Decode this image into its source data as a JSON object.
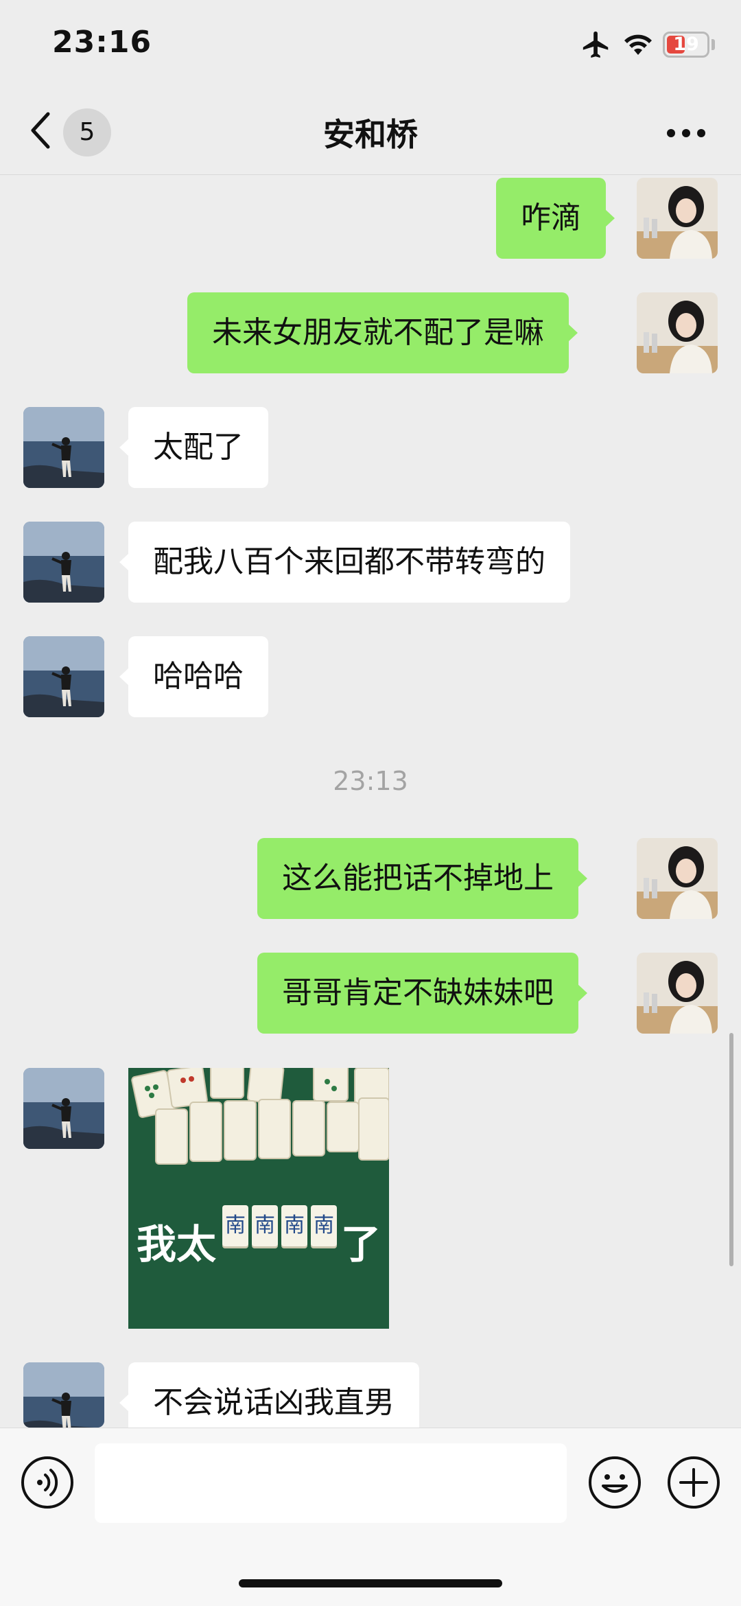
{
  "status_bar": {
    "time": "23:16",
    "battery_level": "19"
  },
  "nav": {
    "unread_count": "5",
    "title": "安和桥"
  },
  "messages": [
    {
      "direction": "out",
      "text": "咋滴"
    },
    {
      "direction": "out",
      "text": "未来女朋友就不配了是嘛"
    },
    {
      "direction": "in",
      "text": "太配了"
    },
    {
      "direction": "in",
      "text": "配我八百个来回都不带转弯的"
    },
    {
      "direction": "in",
      "text": "哈哈哈"
    },
    {
      "type": "timestamp",
      "text": "23:13"
    },
    {
      "direction": "out",
      "text": "这么能把话不掉地上"
    },
    {
      "direction": "out",
      "text": "哥哥肯定不缺妹妹吧"
    },
    {
      "direction": "in",
      "type": "sticker",
      "caption_left": "我太",
      "tiles": [
        "南",
        "南",
        "南",
        "南"
      ],
      "caption_right": "了"
    },
    {
      "direction": "in",
      "text": "不会说话凶我直男"
    }
  ],
  "colors": {
    "outgoing_bubble": "#95ec69",
    "incoming_bubble": "#ffffff",
    "background": "#ededed"
  },
  "input_bar": {
    "voice_icon": "voice-icon",
    "emoji_icon": "emoji-icon",
    "add_icon": "add-icon",
    "draft": ""
  }
}
